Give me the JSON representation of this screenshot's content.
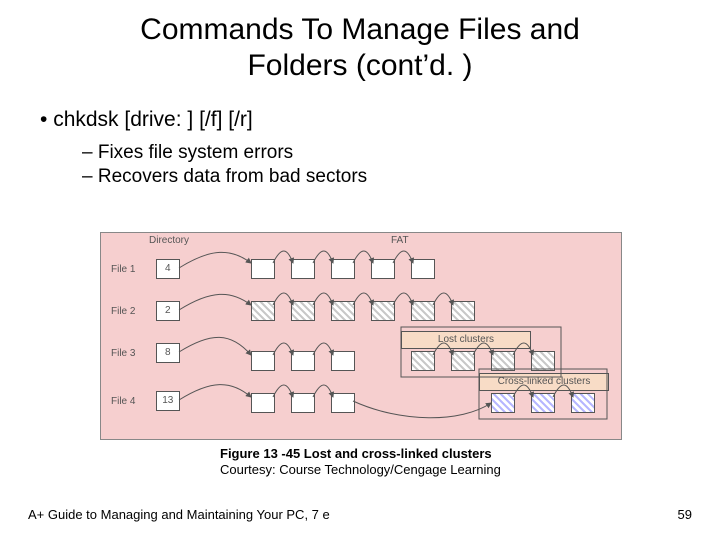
{
  "title_line1": "Commands To Manage Files and",
  "title_line2": "Folders (cont’d. )",
  "bullets": {
    "b1": "chkdsk [drive: ] [/f] [/r]",
    "b2a": "Fixes file system errors",
    "b2b": "Recovers data from bad sectors"
  },
  "figure": {
    "dir_label": "Directory",
    "fat_label": "FAT",
    "rows": [
      {
        "name": "File 1",
        "start": "4"
      },
      {
        "name": "File 2",
        "start": "2"
      },
      {
        "name": "File 3",
        "start": "8"
      },
      {
        "name": "File 4",
        "start": "13"
      }
    ],
    "lost_label": "Lost clusters",
    "cross_label": "Cross-linked clusters"
  },
  "caption_line1": "Figure 13 -45 Lost and cross-linked clusters",
  "caption_line2": "Courtesy: Course Technology/Cengage Learning",
  "footer_left": "A+ Guide to Managing and Maintaining Your PC, 7 e",
  "footer_right": "59"
}
